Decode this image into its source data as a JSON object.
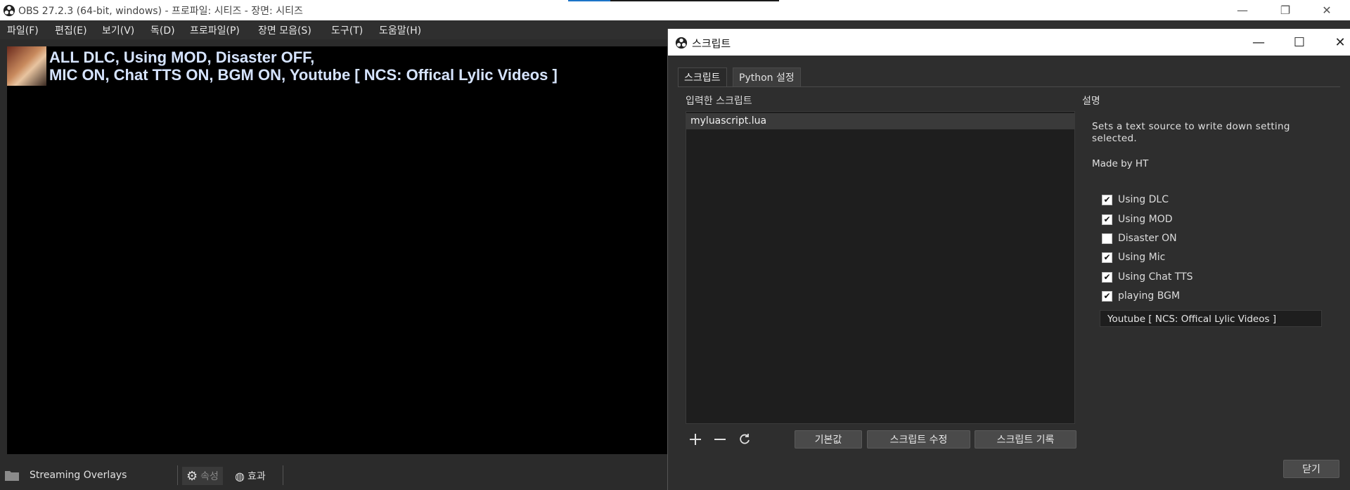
{
  "main_window": {
    "title": "OBS 27.2.3 (64-bit, windows) - 프로파일: 시티즈 - 장면: 시티즈"
  },
  "menubar": {
    "items": [
      "파일(F)",
      "편집(E)",
      "보기(V)",
      "독(D)",
      "프로파일(P)",
      "장면 모음(S)",
      "도구(T)",
      "도움말(H)"
    ]
  },
  "preview": {
    "line1": "ALL DLC, Using MOD, Disaster OFF,",
    "line2": "MIC ON, Chat TTS ON, BGM ON, Youtube [ NCS: Offical Lylic Videos ]"
  },
  "bottom_bar": {
    "scene_name": "Streaming Overlays",
    "properties_label": "속성",
    "filters_label": "효과"
  },
  "scripts_dialog": {
    "title": "스크립트",
    "tabs": [
      "스크립트",
      "Python 설정"
    ],
    "loaded_scripts_label": "입력한 스크립트",
    "scripts": [
      "myluascript.lua"
    ],
    "description_label": "설명",
    "description": "Sets a text source to write down setting selected.",
    "author": "Made by HT",
    "options": [
      {
        "label": "Using DLC",
        "checked": true
      },
      {
        "label": "Using MOD",
        "checked": true
      },
      {
        "label": "Disaster ON",
        "checked": false
      },
      {
        "label": "Using Mic",
        "checked": true
      },
      {
        "label": "Using Chat TTS",
        "checked": true
      },
      {
        "label": "playing BGM",
        "checked": true
      }
    ],
    "text_value": "Youtube [ NCS: Offical Lylic Videos ]",
    "defaults_button": "기본값",
    "edit_script_button": "스크립트 수정",
    "script_log_button": "스크립트 기록",
    "close_button": "닫기"
  },
  "icons": [
    "obs-logo-icon",
    "minimize-icon",
    "restore-icon",
    "maximize-icon",
    "close-icon",
    "add-icon",
    "remove-icon",
    "reload-icon",
    "gear-icon",
    "filter-icon",
    "folder-icon",
    "checkmark-icon"
  ]
}
